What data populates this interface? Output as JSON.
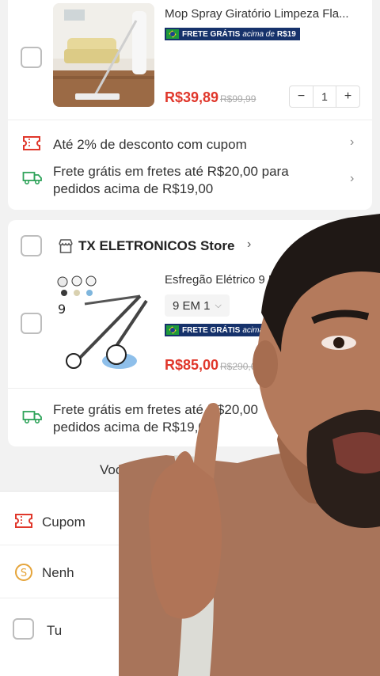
{
  "product1": {
    "title": "Mop Spray Giratório Limpeza Fla...",
    "badge_text": "FRETE GRÁTIS",
    "badge_small": "acima de",
    "badge_amount": "R$19",
    "price": "R$39,89",
    "old_price": "R$99,99",
    "quantity": "1"
  },
  "promo": {
    "coupon_text": "Até 2% de desconto com cupom",
    "shipping_text_1": "Frete grátis em fretes até R$20,00 para",
    "shipping_text_2": "pedidos acima de R$19,00"
  },
  "store2": {
    "name": "TX ELETRONICOS Store"
  },
  "product2": {
    "title": "Esfregão Elétrico 9 E",
    "variant": "9 EM 1",
    "badge_text": "FRETE GRÁTIS",
    "badge_small": "acima de R$",
    "price": "R$85,00",
    "old_price": "R$290,0"
  },
  "shipping2": {
    "text_1": "Frete grátis em fretes até R$20,00",
    "text_2": "pedidos acima de R$19,00"
  },
  "recommend": {
    "label": "Você Tam"
  },
  "bottom": {
    "coupon_label": "Cupom",
    "coins_label": "Nenh",
    "select_all_label": "Tu"
  },
  "colors": {
    "accent": "#e0372b",
    "badge_bg": "#16326b",
    "truck": "#2fa35a"
  }
}
